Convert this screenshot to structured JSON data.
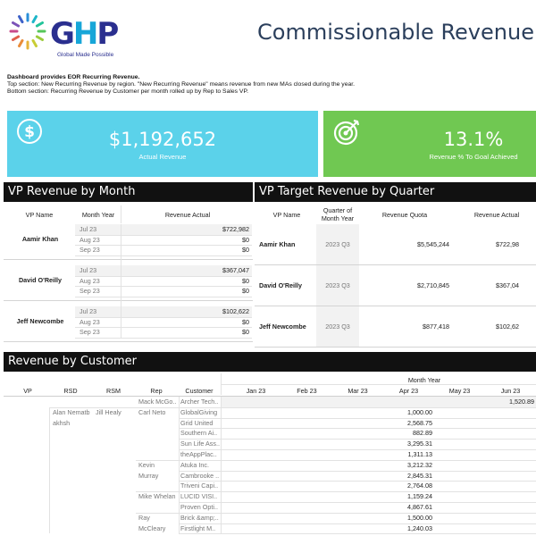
{
  "header": {
    "logo_text_g": "G",
    "logo_text_h": "H",
    "logo_text_p": "P",
    "logo_tagline": "Global Made Possible",
    "title": "Commissionable Revenue"
  },
  "description": {
    "line1": "Dashboard provides EOR Recurring Revenue.",
    "line2": "Top section: New Recurring Revenue by region. \"New Recurring Revenue\" means revenue from new MAs closed during the year.",
    "line3": "Bottom section: Recurring Revenue by Customer per month rolled up by Rep to Sales VP."
  },
  "kpis": {
    "actual": {
      "value": "$1,192,652",
      "label": "Actual Revenue",
      "icon": "dollar-icon",
      "color": "#5bd2ea"
    },
    "goal": {
      "value": "13.1%",
      "label": "Revenue % To Goal Achieved",
      "icon": "target-icon",
      "color": "#70c852"
    }
  },
  "vp_month": {
    "title": "VP Revenue by Month",
    "headers": {
      "vp": "VP Name",
      "month": "Month Year",
      "revenue": "Revenue Actual"
    },
    "groups": [
      {
        "vp": "Aamir Khan",
        "rows": [
          {
            "month": "Jul 23",
            "revenue": "$722,982"
          },
          {
            "month": "Aug 23",
            "revenue": "$0"
          },
          {
            "month": "Sep 23",
            "revenue": "$0"
          }
        ]
      },
      {
        "vp": "David O'Reilly",
        "rows": [
          {
            "month": "Jul 23",
            "revenue": "$367,047"
          },
          {
            "month": "Aug 23",
            "revenue": "$0"
          },
          {
            "month": "Sep 23",
            "revenue": "$0"
          }
        ]
      },
      {
        "vp": "Jeff Newcombe",
        "rows": [
          {
            "month": "Jul 23",
            "revenue": "$102,622"
          },
          {
            "month": "Aug 23",
            "revenue": "$0"
          },
          {
            "month": "Sep 23",
            "revenue": "$0"
          }
        ]
      }
    ]
  },
  "vp_target": {
    "title": "VP Target Revenue by Quarter",
    "headers": {
      "vp": "VP Name",
      "quarter_l1": "Quarter of",
      "quarter_l2": "Month Year",
      "quota": "Revenue Quota",
      "actual": "Revenue Actual"
    },
    "rows": [
      {
        "vp": "Aamir Khan",
        "quarter": "2023 Q3",
        "quota": "$5,545,244",
        "actual": "$722,98"
      },
      {
        "vp": "David O'Reilly",
        "quarter": "2023 Q3",
        "quota": "$2,710,845",
        "actual": "$367,04"
      },
      {
        "vp": "Jeff Newcombe",
        "quarter": "2023 Q3",
        "quota": "$877,418",
        "actual": "$102,62"
      }
    ]
  },
  "customer": {
    "title": "Revenue by Customer",
    "month_year_label": "Month Year",
    "headers": {
      "vp": "VP",
      "rsd": "RSD",
      "rsm": "RSM",
      "rep": "Rep",
      "customer": "Customer"
    },
    "months": [
      "Jan 23",
      "Feb 23",
      "Mar 23",
      "Apr 23",
      "May 23",
      "Jun 23"
    ],
    "rsd": {
      "line1": "Alan Nematb",
      "line2": "akhsh"
    },
    "rsm": "Jill Healy",
    "rep_labels": {
      "mack": "Mack McGo..",
      "alan": "Alan Nematb",
      "carl": "Carl Neto",
      "kevin1": "Kevin",
      "kevin2": "Murray",
      "mike": "Mike Whelan",
      "ray1": "Ray",
      "ray2": "McCleary"
    },
    "rows": [
      {
        "customer": "Archer Tech..",
        "apr": "",
        "jun": "1,520.89"
      },
      {
        "customer": "GlobalGiving",
        "apr": "1,000.00",
        "jun": ""
      },
      {
        "customer": "Grid United",
        "apr": "2,568.75",
        "jun": ""
      },
      {
        "customer": "Southern Ai..",
        "apr": "882.89",
        "jun": ""
      },
      {
        "customer": "Sun Life Ass..",
        "apr": "3,295.31",
        "jun": ""
      },
      {
        "customer": "theAppPlac..",
        "apr": "1,311.13",
        "jun": ""
      },
      {
        "customer": "Atuka Inc.",
        "apr": "3,212.32",
        "jun": ""
      },
      {
        "customer": "Cambrooke ..",
        "apr": "2,845.31",
        "jun": ""
      },
      {
        "customer": "Triveni Capi..",
        "apr": "2,764.08",
        "jun": ""
      },
      {
        "customer": "LUCID VISI..",
        "apr": "1,159.24",
        "jun": ""
      },
      {
        "customer": "Proven Opti..",
        "apr": "4,867.61",
        "jun": ""
      },
      {
        "customer": "Brick &amp;..",
        "apr": "1,500.00",
        "jun": ""
      },
      {
        "customer": "Firstlight M..",
        "apr": "1,240.03",
        "jun": ""
      }
    ]
  }
}
